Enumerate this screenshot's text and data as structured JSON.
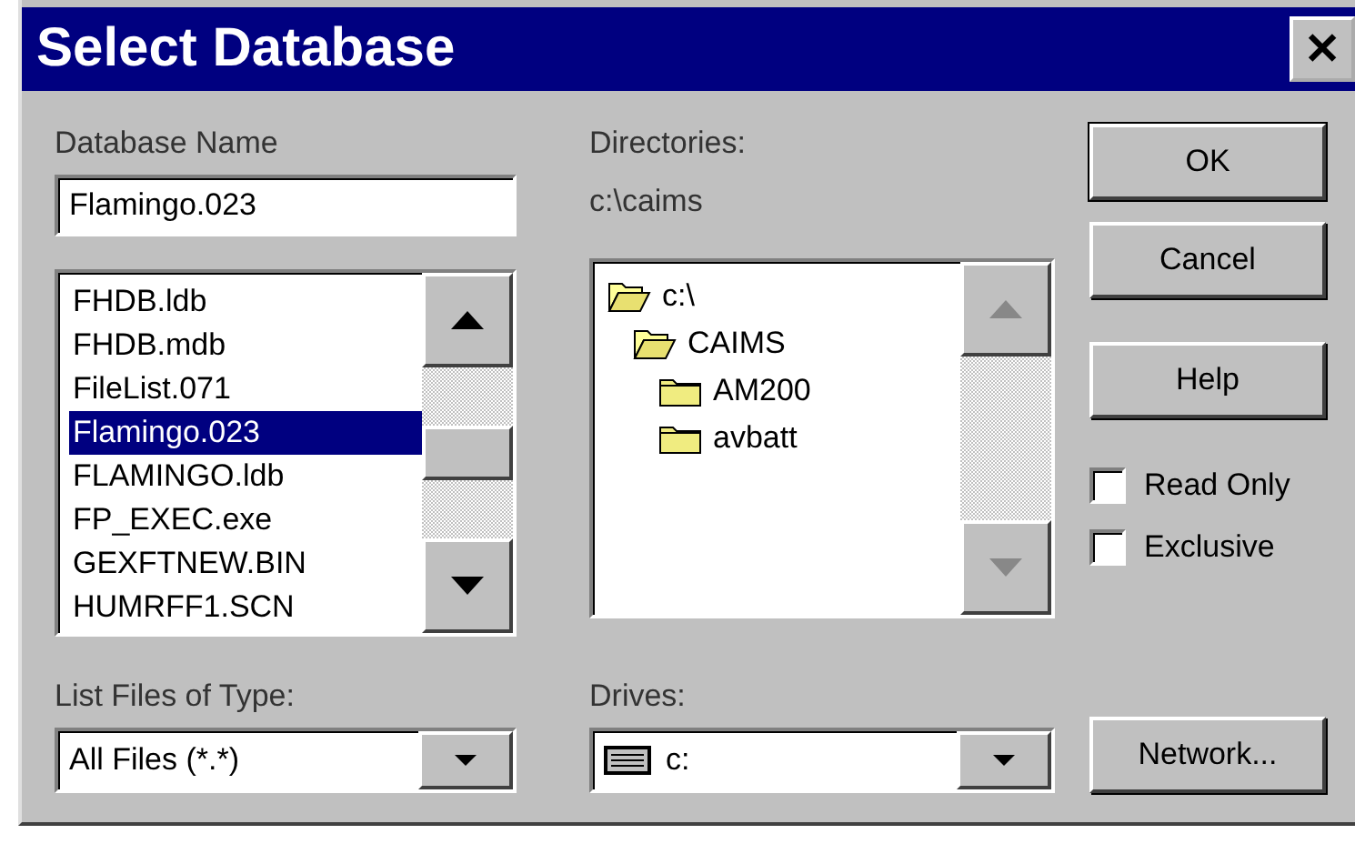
{
  "window": {
    "title": "Select Database",
    "close": "✕"
  },
  "database_name": {
    "label": "Database Name",
    "value": "Flamingo.023"
  },
  "files": [
    {
      "name": "FHDB.ldb",
      "selected": false
    },
    {
      "name": "FHDB.mdb",
      "selected": false
    },
    {
      "name": "FileList.071",
      "selected": false
    },
    {
      "name": "Flamingo.023",
      "selected": true
    },
    {
      "name": "FLAMINGO.ldb",
      "selected": false
    },
    {
      "name": "FP_EXEC.exe",
      "selected": false
    },
    {
      "name": "GEXFTNEW.BIN",
      "selected": false
    },
    {
      "name": "HUMRFF1.SCN",
      "selected": false
    }
  ],
  "directories": {
    "label": "Directories:",
    "path": "c:\\caims",
    "tree": [
      {
        "name": "c:\\",
        "expanded": true,
        "children": [
          {
            "name": "CAIMS",
            "expanded": true,
            "children": [
              {
                "name": "AM200",
                "expanded": false
              },
              {
                "name": "avbatt",
                "expanded": false
              }
            ]
          }
        ]
      }
    ]
  },
  "buttons": {
    "ok": "OK",
    "cancel": "Cancel",
    "help": "Help",
    "network": "Network..."
  },
  "options": [
    {
      "label": "Read Only",
      "checked": false
    },
    {
      "label": "Exclusive",
      "checked": false
    }
  ],
  "file_type": {
    "label": "List Files of Type:",
    "value": "All Files (*.*)"
  },
  "drives": {
    "label": "Drives:",
    "value": "c:"
  }
}
